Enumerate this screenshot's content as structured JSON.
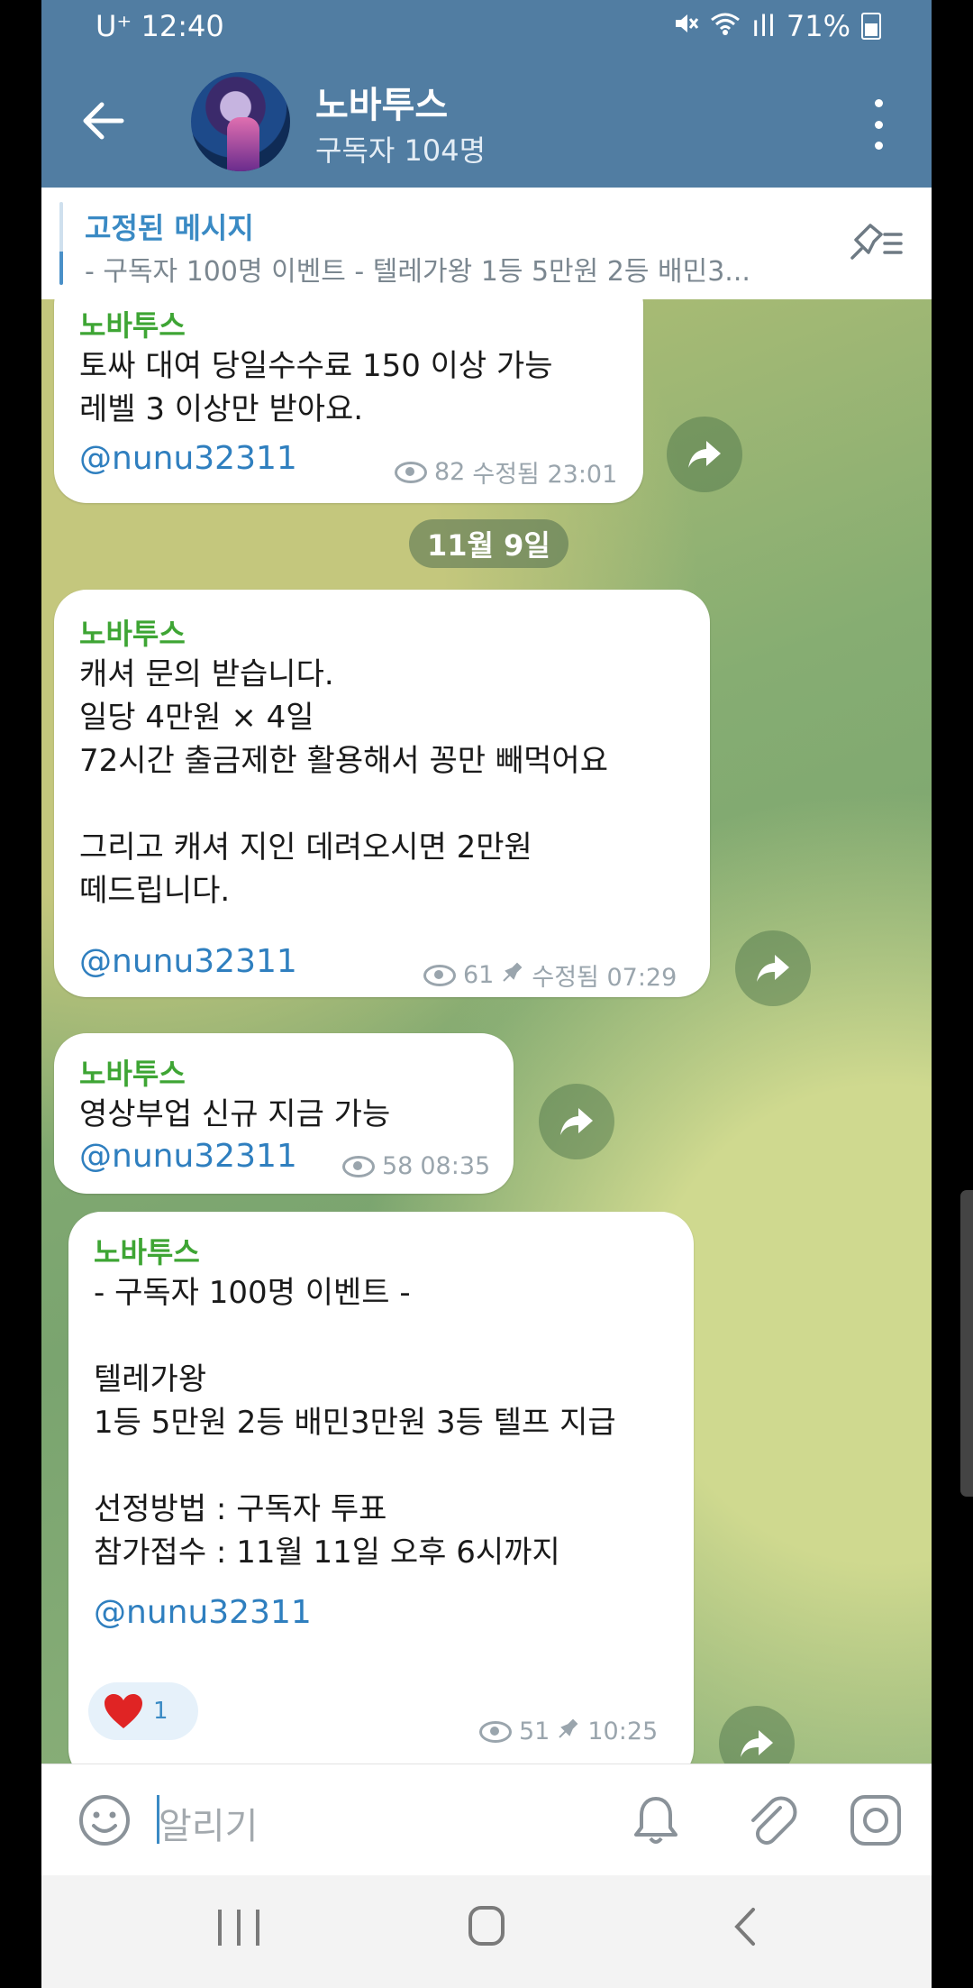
{
  "status": {
    "carrier": "U⁺ 12:40",
    "signal": "ıll",
    "battery": "71%"
  },
  "header": {
    "title": "노바투스",
    "subtitle": "구독자 104명"
  },
  "pinned": {
    "title": "고정된 메시지",
    "text": "- 구독자 100명 이벤트 -  텔레가왕 1등 5만원 2등 배민3..."
  },
  "date_chip": "11월 9일",
  "messages": [
    {
      "sender": "노바투스",
      "text": "토싸 대여 당일수수료 150 이상 가능\n레벨 3 이상만 받아요.",
      "link": "@nunu32311",
      "views": "82",
      "time": "수정됨 23:01"
    },
    {
      "sender": "노바투스",
      "text": "캐셔 문의 받습니다.\n일당 4만원 × 4일\n72시간 출금제한 활용해서 꽁만 빼먹어요\n\n그리고 캐셔 지인 데려오시면 2만원\n떼드립니다.",
      "link": "@nunu32311",
      "views": "61",
      "time": "수정됨 07:29"
    },
    {
      "sender": "노바투스",
      "text": "영상부업 신규 지금 가능",
      "link": "@nunu32311",
      "views": "58",
      "time": "08:35"
    },
    {
      "sender": "노바투스",
      "text": "- 구독자 100명 이벤트 -\n\n텔레가왕\n1등 5만원 2등 배민3만원 3등 텔프 지급\n\n선정방법 : 구독자 투표\n참가접수 : 11월 11일 오후 6시까지",
      "link": "@nunu32311",
      "reaction_count": "1",
      "views": "51",
      "time": "10:25"
    }
  ],
  "input": {
    "placeholder": "알리기"
  },
  "colors": {
    "header": "#517da2",
    "sender": "#3ea534",
    "link": "#2f7fbf"
  }
}
